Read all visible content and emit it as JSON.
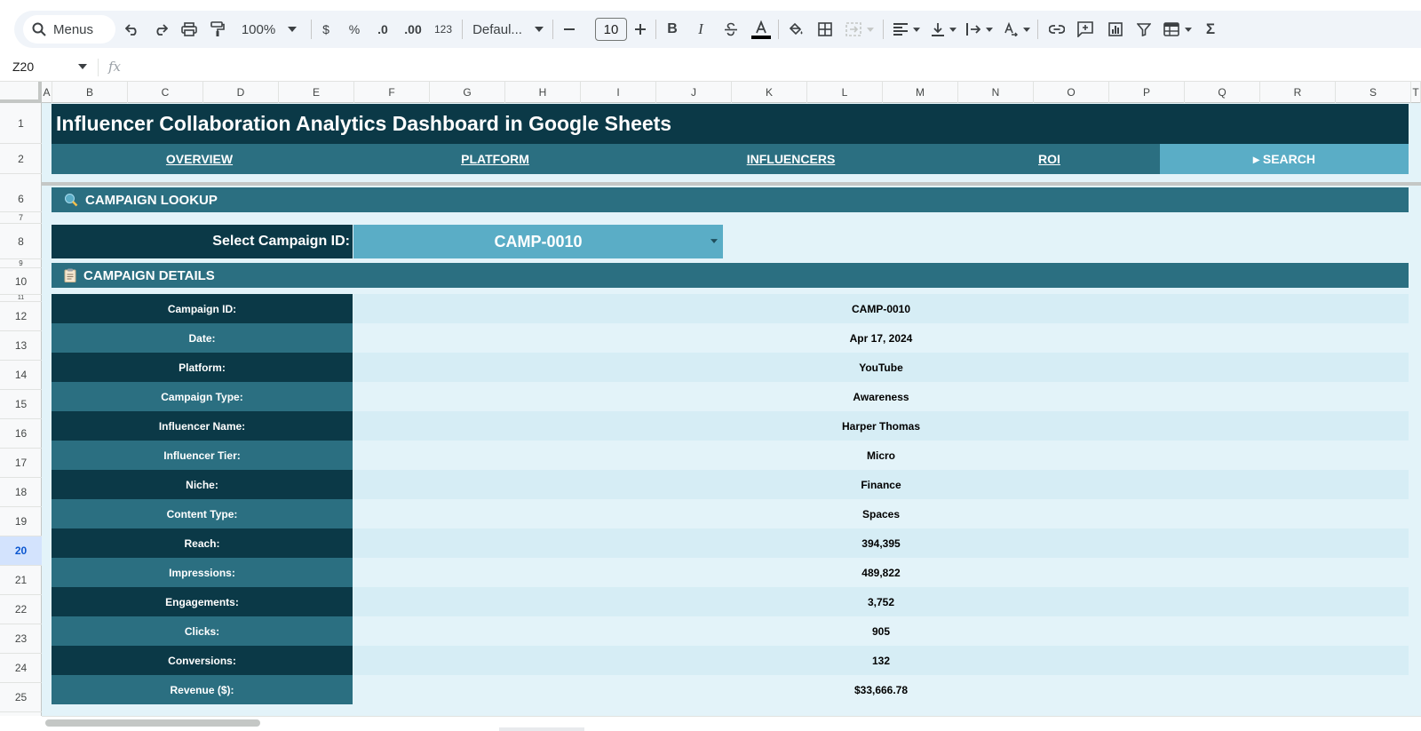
{
  "toolbar": {
    "search_label": "Menus",
    "zoom": "100%",
    "currency": "$",
    "percent": "%",
    "decrease_decimal": ".0",
    "increase_decimal": ".00",
    "number_format": "123",
    "font": "Defaul...",
    "font_size": "10",
    "bold": "B",
    "italic": "I",
    "sigma": "Σ"
  },
  "formula_bar": {
    "cell_ref": "Z20",
    "fx": "fx"
  },
  "columns": [
    "A",
    "B",
    "C",
    "D",
    "E",
    "F",
    "G",
    "H",
    "I",
    "J",
    "K",
    "L",
    "M",
    "N",
    "O",
    "P",
    "Q",
    "R",
    "S",
    "T"
  ],
  "rows": [
    {
      "n": "1"
    },
    {
      "n": "2"
    },
    {
      "n": "6"
    },
    {
      "n": "7"
    },
    {
      "n": "8"
    },
    {
      "n": "9"
    },
    {
      "n": "10"
    },
    {
      "n": "11"
    },
    {
      "n": "12"
    },
    {
      "n": "13"
    },
    {
      "n": "14"
    },
    {
      "n": "15"
    },
    {
      "n": "16"
    },
    {
      "n": "17"
    },
    {
      "n": "18"
    },
    {
      "n": "19"
    },
    {
      "n": "20"
    },
    {
      "n": "21"
    },
    {
      "n": "22"
    },
    {
      "n": "23"
    },
    {
      "n": "24"
    },
    {
      "n": "25"
    }
  ],
  "active_row": "20",
  "title": "Influencer Collaboration Analytics Dashboard in Google Sheets",
  "nav": [
    {
      "label": "OVERVIEW"
    },
    {
      "label": "PLATFORM"
    },
    {
      "label": "INFLUENCERS"
    },
    {
      "label": "ROI"
    },
    {
      "label": "▸ SEARCH",
      "active": true
    }
  ],
  "lookup": {
    "section_title": "CAMPAIGN LOOKUP",
    "label": "Select Campaign ID:",
    "selected": "CAMP-0010"
  },
  "details": {
    "section_title": "CAMPAIGN DETAILS",
    "rows": [
      {
        "label": "Campaign ID:",
        "value": "CAMP-0010"
      },
      {
        "label": "Date:",
        "value": "Apr 17, 2024"
      },
      {
        "label": "Platform:",
        "value": "YouTube"
      },
      {
        "label": "Campaign Type:",
        "value": "Awareness"
      },
      {
        "label": "Influencer Name:",
        "value": "Harper Thomas"
      },
      {
        "label": "Influencer Tier:",
        "value": "Micro"
      },
      {
        "label": "Niche:",
        "value": "Finance"
      },
      {
        "label": "Content Type:",
        "value": "Spaces"
      },
      {
        "label": "Reach:",
        "value": "394,395"
      },
      {
        "label": "Impressions:",
        "value": "489,822"
      },
      {
        "label": "Engagements:",
        "value": "3,752"
      },
      {
        "label": "Clicks:",
        "value": "905"
      },
      {
        "label": "Conversions:",
        "value": "132"
      },
      {
        "label": "Revenue ($):",
        "value": "$33,666.78"
      }
    ]
  },
  "colors": {
    "dark_teal": "#0b3947",
    "mid_teal": "#2b6f81",
    "light_teal": "#5aadc6",
    "sheet_bg": "#e3f3f9"
  }
}
